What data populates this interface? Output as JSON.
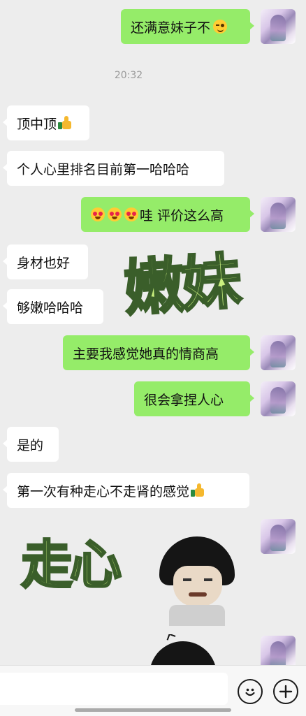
{
  "timestamp": "20:32",
  "messages": {
    "m1": {
      "text": "还满意妹子不",
      "side": "out",
      "emoji": "wink-face"
    },
    "m2": {
      "text": "顶中顶",
      "side": "in",
      "emoji": "thumbs-up"
    },
    "m3": {
      "text": "个人心里排名目前第一哈哈哈",
      "side": "in"
    },
    "m4": {
      "text": "哇 评价这么高",
      "side": "out",
      "emoji": "heart-eyes-x3"
    },
    "m5": {
      "text": "身材也好",
      "side": "in"
    },
    "m6": {
      "text": "够嫩哈哈哈",
      "side": "in"
    },
    "m7": {
      "text": "主要我感觉她真的情商高",
      "side": "out"
    },
    "m8": {
      "text": "很会拿捏人心",
      "side": "out"
    },
    "m9": {
      "text": "是的",
      "side": "in"
    },
    "m10": {
      "text": "第一次有种走心不走肾的感觉",
      "side": "in",
      "emoji": "thumbs-up"
    }
  },
  "stickers": {
    "s1": {
      "text": "嫩妹"
    },
    "s2": {
      "text": "走心"
    }
  },
  "toolbar": {
    "emoji_icon": "smiley-icon",
    "plus_icon": "plus-icon"
  },
  "colors": {
    "outgoing_bubble": "#95ec69",
    "incoming_bubble": "#ffffff",
    "background": "#ededed"
  }
}
